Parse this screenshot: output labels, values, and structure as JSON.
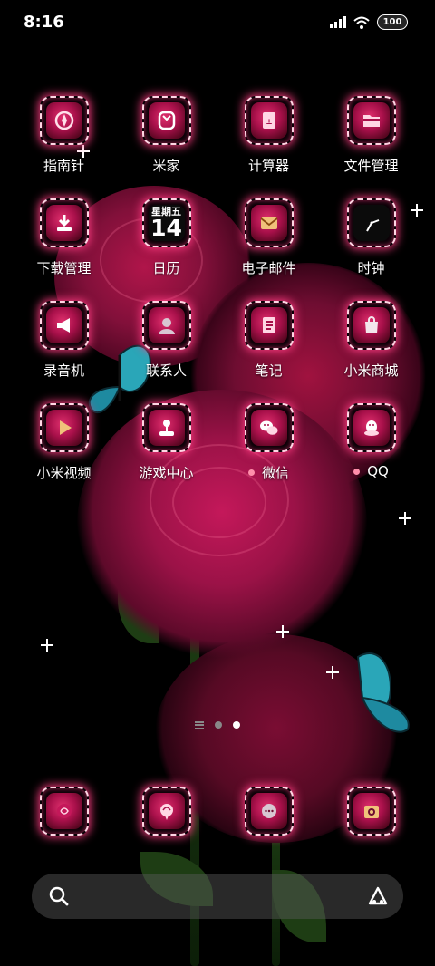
{
  "status_bar": {
    "time": "8:16",
    "battery": "100"
  },
  "apps": [
    {
      "label": "指南针",
      "icon": "compass-icon"
    },
    {
      "label": "米家",
      "icon": "mi-home-icon"
    },
    {
      "label": "计算器",
      "icon": "calculator-icon"
    },
    {
      "label": "文件管理",
      "icon": "folder-icon"
    },
    {
      "label": "下载管理",
      "icon": "download-icon"
    },
    {
      "label": "日历",
      "icon": "calendar-icon",
      "weekday": "星期五",
      "day": "14"
    },
    {
      "label": "电子邮件",
      "icon": "mail-icon"
    },
    {
      "label": "时钟",
      "icon": "clock-icon"
    },
    {
      "label": "录音机",
      "icon": "megaphone-icon"
    },
    {
      "label": "联系人",
      "icon": "contact-icon"
    },
    {
      "label": "笔记",
      "icon": "notes-icon"
    },
    {
      "label": "小米商城",
      "icon": "shopping-bag-icon"
    },
    {
      "label": "小米视频",
      "icon": "play-icon"
    },
    {
      "label": "游戏中心",
      "icon": "joystick-icon"
    },
    {
      "label": "微信",
      "icon": "wechat-icon",
      "badge_dot": true
    },
    {
      "label": "QQ",
      "icon": "qq-icon",
      "badge_dot": true
    }
  ],
  "dock": [
    {
      "icon": "phone-rose-icon"
    },
    {
      "icon": "messages-rose-icon"
    },
    {
      "icon": "chat-bubble-icon"
    },
    {
      "icon": "camera-icon"
    }
  ],
  "page_indicator": {
    "pages": 2,
    "active": 2
  },
  "search_bar": {
    "left_icon": "search-icon",
    "right_icon": "assistant-icon"
  },
  "colors": {
    "glow": "#ff3c82",
    "rose": "#a8104a",
    "badge_dot": "#ff8fab"
  }
}
